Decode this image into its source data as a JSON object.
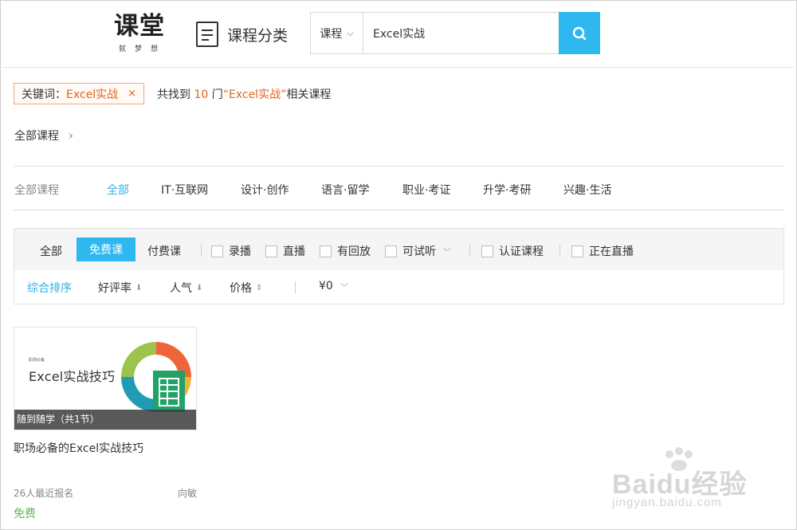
{
  "header": {
    "logo_main": "课堂",
    "logo_sub": "就梦想",
    "category_label": "课程分类",
    "search_scope": "课程",
    "search_value": "Excel实战"
  },
  "keyword": {
    "label": "关键词：",
    "value": "Excel实战",
    "close": "×"
  },
  "result": {
    "prefix": "共找到 ",
    "count": "10",
    "middle": " 门",
    "keyword_quoted": "“Excel实战”",
    "suffix": "相关课程"
  },
  "breadcrumb": {
    "label": "全部课程",
    "arrow": "›"
  },
  "categories": {
    "label": "全部课程",
    "tabs": [
      "全部",
      "IT·互联网",
      "设计·创作",
      "语言·留学",
      "职业·考证",
      "升学·考研",
      "兴趣·生活"
    ],
    "active_index": 0
  },
  "filters": {
    "all": "全部",
    "free": "免费课",
    "paid": "付费课",
    "recorded": "录播",
    "live": "直播",
    "replay": "有回放",
    "trial": "可试听",
    "certified": "认证课程",
    "live_now": "正在直播"
  },
  "sort": {
    "overall": "综合排序",
    "rating": "好评率",
    "popularity": "人气",
    "price": "价格",
    "price_filter": "¥0"
  },
  "course": {
    "thumb_small": "职场必备",
    "thumb_title": "Excel实战技巧",
    "overlay": "随到随学（共1节）",
    "title": "职场必备的Excel实战技巧",
    "enrolled": "26人最近报名",
    "teacher": "向敏",
    "price": "免费"
  },
  "watermark": {
    "text": "Baidu经验",
    "sub": "jingyan.baidu.com"
  },
  "colors": {
    "accent": "#2fb8f0",
    "keyword_orange": "#e0651d",
    "free_green": "#5cb85c"
  }
}
